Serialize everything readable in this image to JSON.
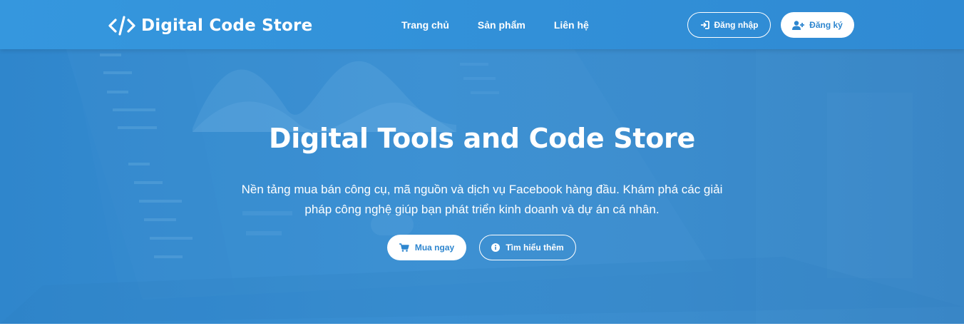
{
  "brand": {
    "name": "Digital Code Store",
    "icon": "code-icon"
  },
  "nav": {
    "items": [
      {
        "label": "Trang chủ"
      },
      {
        "label": "Sản phẩm"
      },
      {
        "label": "Liên hệ"
      }
    ]
  },
  "auth": {
    "login_label": "Đăng nhập",
    "login_icon": "sign-in-icon",
    "register_label": "Đăng ký",
    "register_icon": "user-plus-icon"
  },
  "hero": {
    "title": "Digital Tools and Code Store",
    "description_line1": "Nền tảng mua bán công cụ, mã nguồn và dịch vụ Facebook hàng đầu. Khám phá các giải",
    "description_line2": "pháp công nghệ giúp bạn phát triển kinh doanh và dự án cá nhân.",
    "buy_label": "Mua ngay",
    "buy_icon": "cart-icon",
    "learn_label": "Tìm hiểu thêm",
    "learn_icon": "info-icon"
  },
  "colors": {
    "primary": "#2f8ad3",
    "button_text": "#2e86cf",
    "white": "#ffffff"
  }
}
